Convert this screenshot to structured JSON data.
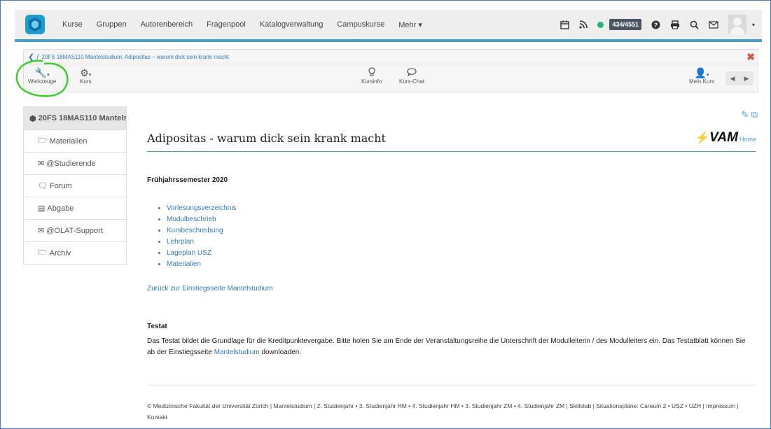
{
  "navbar": {
    "items": [
      "Kurse",
      "Gruppen",
      "Autorenbereich",
      "Fragenpool",
      "Katalogverwaltung",
      "Campuskurse",
      "Mehr ▾"
    ],
    "counter": "434/4551",
    "status_color": "#2ab27b"
  },
  "breadcrumb": {
    "text": "20FS 18MAS110 Mantelstudium: Adipositas – warum dick sein krank macht"
  },
  "toolbar": {
    "werkzeuge": "Werkzeuge",
    "kurs": "Kurs",
    "kursinfo": "Kursinfo",
    "kurs_chat": "Kurs-Chat",
    "mein_kurs": "Mein Kurs"
  },
  "sidebar": {
    "title": "20FS 18MAS110 Mantelst",
    "items": [
      {
        "label": "Materialien",
        "icon": "folder-icon"
      },
      {
        "label": "@Studierende",
        "icon": "mail-icon"
      },
      {
        "label": "Forum",
        "icon": "forum-icon"
      },
      {
        "label": "Abgabe",
        "icon": "inbox-icon"
      },
      {
        "label": "@OLAT-Support",
        "icon": "mail-icon"
      },
      {
        "label": "Archiv",
        "icon": "folder-icon"
      }
    ]
  },
  "main": {
    "title": "Adipositas - warum dick sein krank macht",
    "logo_text": "VAM",
    "logo_home": "Home",
    "semester": "Frühjahrssemester 2020",
    "links": [
      "Vorlesungsverzeichnis",
      "Modulbeschrieb",
      "Kursbeschreibung",
      "Lehrplan",
      "Lageplan USZ",
      "Materialien"
    ],
    "back_link": "Zurück zur Einstiegsseite Mantelstudium",
    "testat_heading": "Testat",
    "testat_text_1": "Das Testat bildet die Grundlage für die Kreditpunktevergabe. Bitte holen Sie am Ende der Veranstaltungsreihe die Unterschrift der Modulleiterin / des Modulleiters ein. Das Testatblatt können Sie ab der Einstiegsseite",
    "testat_link": "Mantelstudium",
    "testat_text_2": "downloaden.",
    "footer": "© Medizinische Fakultät der Universität Zürich | Mantelstudium | 2. Studienjahr • 3. Studienjahr HM • 4. Studienjahr HM • 3. Studienjahr ZM • 4. Studienjahr ZM | Skillslab | Situationspläne: Careum 2 • USZ • UZH | Impressum | Kontakt"
  },
  "colors": {
    "accent": "#4a9fc5",
    "link": "#337ab7",
    "annotation": "#3ccd2a",
    "close": "#d9534f"
  }
}
